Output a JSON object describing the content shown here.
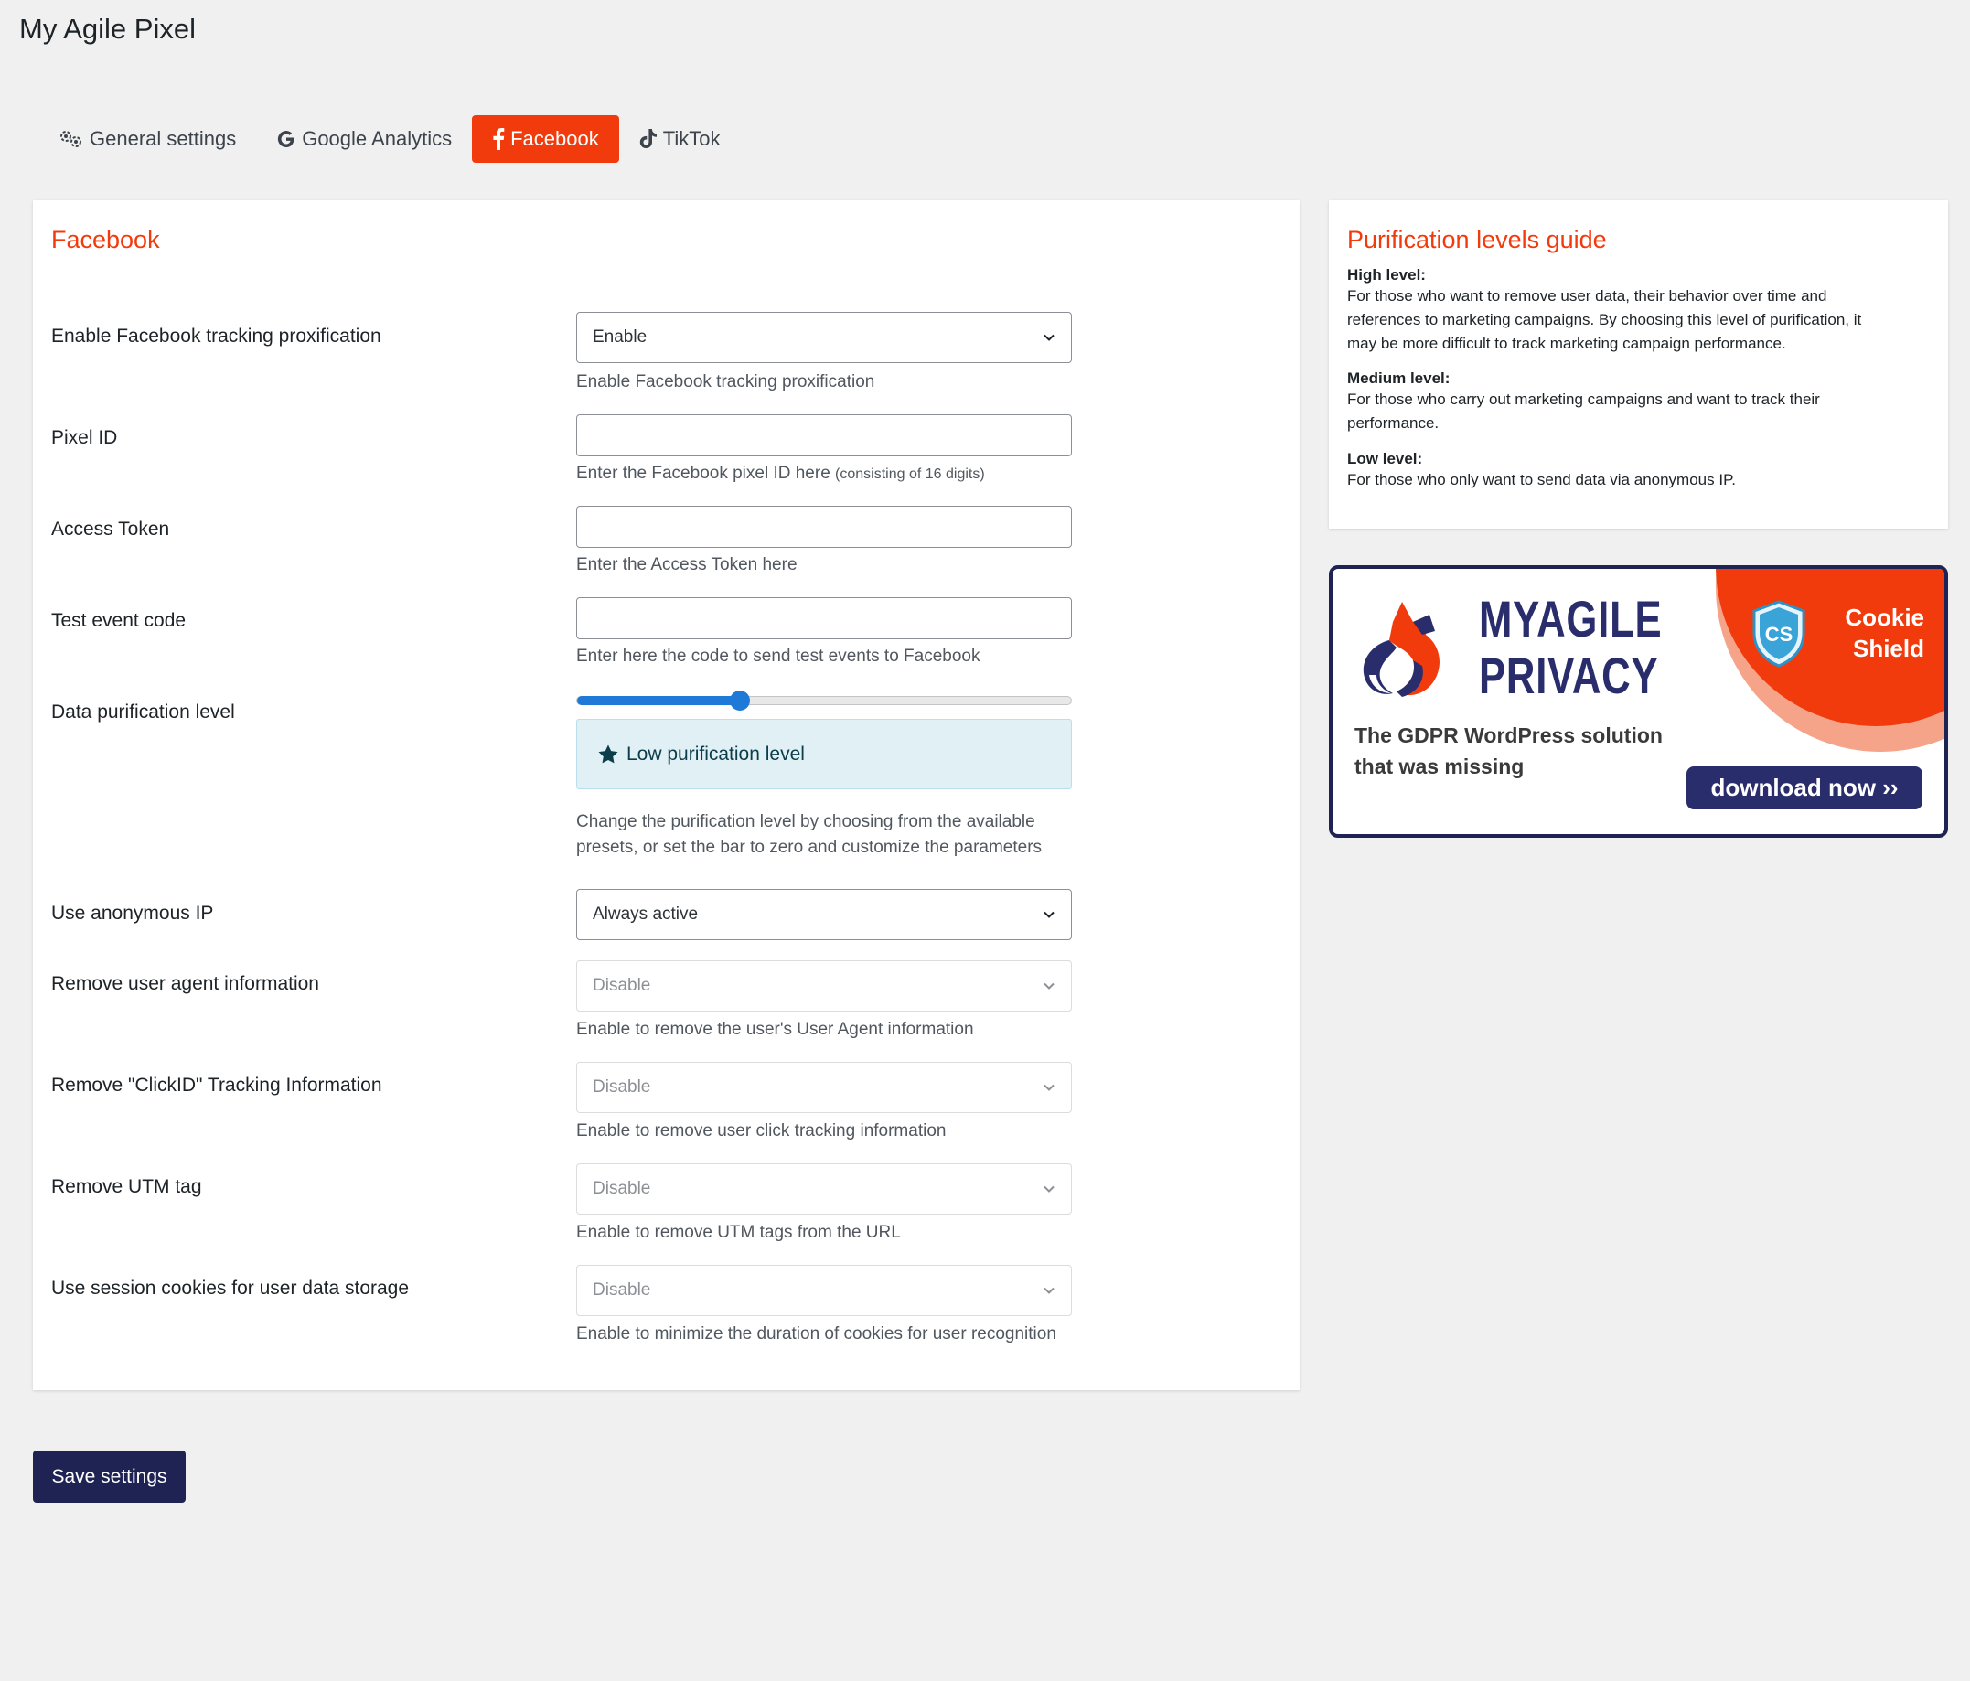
{
  "page": {
    "title": "My Agile Pixel"
  },
  "tabs": [
    {
      "label": "General settings",
      "icon": "gears-icon",
      "active": false
    },
    {
      "label": "Google Analytics",
      "icon": "google-icon",
      "active": false
    },
    {
      "label": "Facebook",
      "icon": "facebook-icon",
      "active": true
    },
    {
      "label": "TikTok",
      "icon": "tiktok-icon",
      "active": false
    }
  ],
  "colors": {
    "accent": "#f13b0c",
    "primary_button": "#1f2354",
    "slider": "#1e7ad6"
  },
  "main": {
    "title": "Facebook",
    "fields": {
      "proxification": {
        "label": "Enable Facebook tracking proxification",
        "value": "Enable",
        "description": "Enable Facebook tracking proxification"
      },
      "pixel_id": {
        "label": "Pixel ID",
        "value": "",
        "description": "Enter the Facebook pixel ID here",
        "description_note": "(consisting of 16 digits)"
      },
      "access_token": {
        "label": "Access Token",
        "value": "",
        "description": "Enter the Access Token here"
      },
      "test_event": {
        "label": "Test event code",
        "value": "",
        "description": "Enter here the code to send test events to Facebook"
      },
      "purification": {
        "label": "Data purification level",
        "slider_fraction": 0.33,
        "level_text": "Low purification level",
        "description_line1": "Change the purification level by choosing from the available",
        "description_line2": "presets, or set the bar to zero and customize the parameters"
      },
      "anonymous_ip": {
        "label": "Use anonymous IP",
        "value": "Always active"
      },
      "user_agent": {
        "label": "Remove user agent information",
        "value": "Disable",
        "description": "Enable to remove the user's User Agent information"
      },
      "click_id": {
        "label": "Remove \"ClickID\" Tracking Information",
        "value": "Disable",
        "description": "Enable to remove user click tracking information"
      },
      "utm": {
        "label": "Remove UTM tag",
        "value": "Disable",
        "description": "Enable to remove UTM tags from the URL"
      },
      "session_cookies": {
        "label": "Use session cookies for user data storage",
        "value": "Disable",
        "description": "Enable to minimize the duration of cookies for user recognition"
      }
    }
  },
  "guide": {
    "title": "Purification levels guide",
    "levels": [
      {
        "heading": "High level:",
        "lines": [
          "For those who want to remove user data, their behavior over time and",
          "references to marketing campaigns. By choosing this level of purification, it",
          "may be more difficult to track marketing campaign performance."
        ]
      },
      {
        "heading": "Medium level:",
        "lines": [
          "For those who carry out marketing campaigns and want to track their",
          "performance."
        ]
      },
      {
        "heading": "Low level:",
        "lines": [
          "For those who only want to send data via anonymous IP."
        ]
      }
    ]
  },
  "banner": {
    "brand_line1": "MYAGILE",
    "brand_line2": "PRIVACY",
    "tagline_line1": "The GDPR WordPress solution",
    "tagline_line2": "that was missing",
    "badge_line1": "Cookie",
    "badge_line2": "Shield",
    "badge_shield_text": "CS",
    "cta": "download now ››"
  },
  "footer": {
    "save_label": "Save settings"
  }
}
